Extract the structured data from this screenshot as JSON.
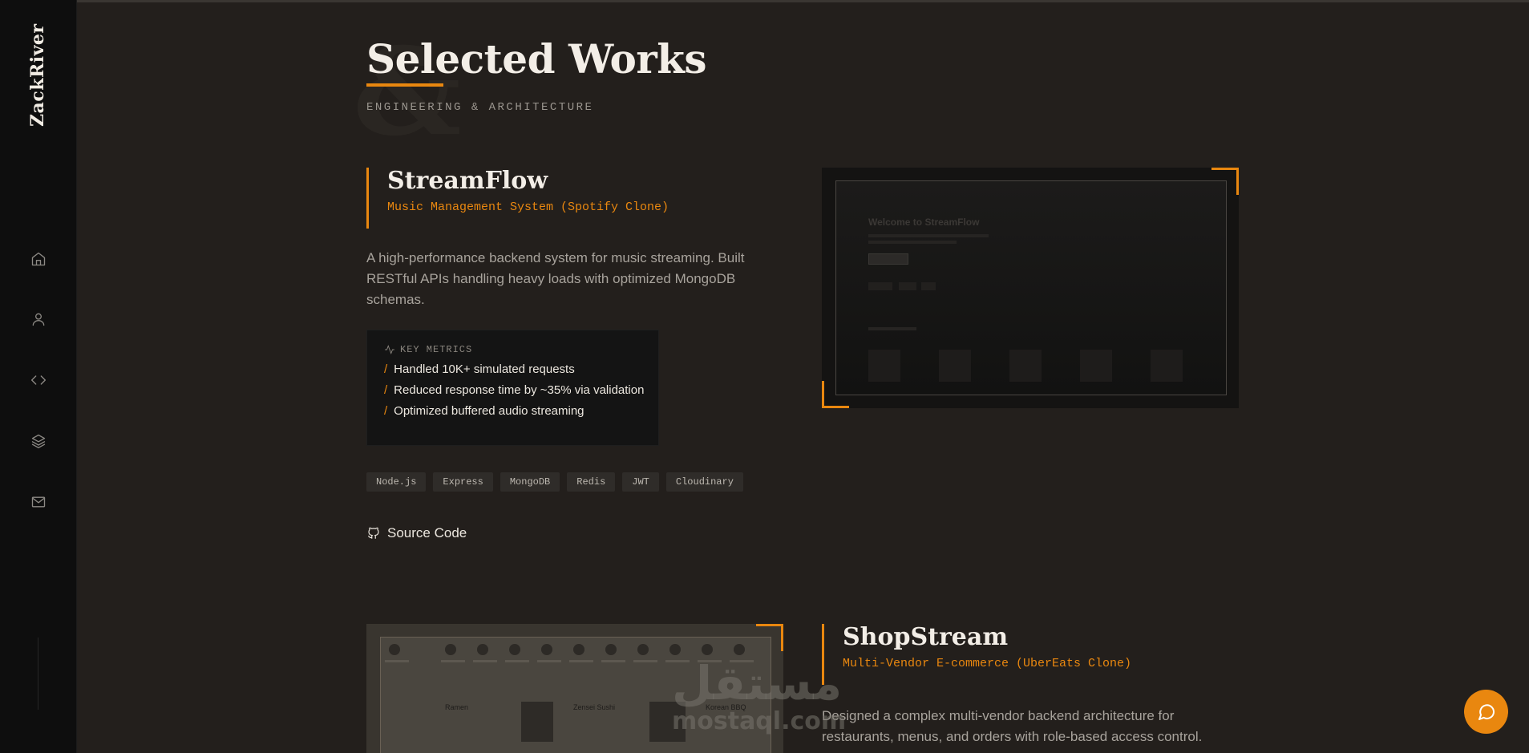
{
  "sidebar": {
    "logo": "ZackRiver",
    "nav": [
      {
        "name": "home",
        "icon": "home-icon"
      },
      {
        "name": "about",
        "icon": "user-icon"
      },
      {
        "name": "projects",
        "icon": "code-icon"
      },
      {
        "name": "stack",
        "icon": "layers-icon"
      },
      {
        "name": "contact",
        "icon": "mail-icon"
      }
    ]
  },
  "header": {
    "title": "Selected Works",
    "subtitle": "ENGINEERING & ARCHITECTURE"
  },
  "projects": [
    {
      "name": "StreamFlow",
      "subtitle": "Music Management System (Spotify Clone)",
      "description": "A high-performance backend system for music streaming. Built RESTful APIs handling heavy loads with optimized MongoDB schemas.",
      "metrics_label": "KEY METRICS",
      "metrics": [
        "Handled 10K+ simulated requests",
        "Reduced response time by ~35% via validation",
        "Optimized buffered audio streaming"
      ],
      "tags": [
        "Node.js",
        "Express",
        "MongoDB",
        "Redis",
        "JWT",
        "Cloudinary"
      ],
      "source_label": "Source Code",
      "preview_title": "Welcome to StreamFlow"
    },
    {
      "name": "ShopStream",
      "subtitle": "Multi-Vendor E-commerce (UberEats Clone)",
      "description": "Designed a complex multi-vendor backend architecture for restaurants, menus, and orders with role-based access control.",
      "preview_cards": [
        "Ramen",
        "Zensei Sushi",
        "Korean BBQ"
      ]
    }
  ],
  "watermark": {
    "arabic": "مستقل",
    "latin": "mostaql.com"
  },
  "colors": {
    "accent": "#e9870f",
    "background": "#231f1c",
    "sidebar": "#0e0e0e"
  }
}
